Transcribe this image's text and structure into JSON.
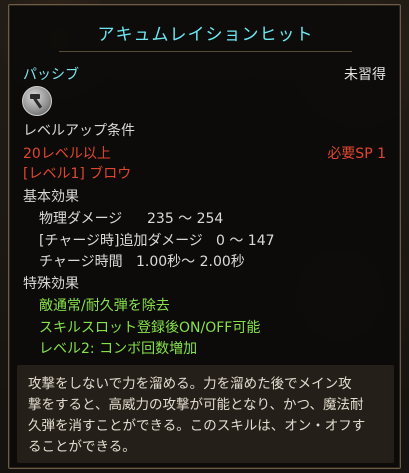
{
  "skill": {
    "name": "アキュムレイションヒット",
    "type": "パッシブ",
    "status": "未習得",
    "icon": "hammer-icon"
  },
  "levelup": {
    "title": "レベルアップ条件",
    "required_level": "20レベル以上",
    "required_sp": "必要SP 1",
    "prereq": "[レベル1] ブロウ"
  },
  "basic": {
    "title": "基本効果",
    "rows": [
      {
        "label": "物理ダメージ",
        "value": "235 ～ 254"
      },
      {
        "label": "[チャージ時]追加ダメージ",
        "value": "0 ～ 147"
      },
      {
        "label": "チャージ時間",
        "value": "1.00秒～ 2.00秒"
      }
    ]
  },
  "special": {
    "title": "特殊効果",
    "lines": [
      "敵通常/耐久弾を除去",
      "スキルスロット登録後ON/OFF可能",
      "レベル2: コンボ回数増加"
    ]
  },
  "description": "攻撃をしないで力を溜める。力を溜めた後でメイン攻\n撃をすると、高威力の攻撃が可能となり、かつ、魔法耐\n久弾を消すことができる。このスキルは、オン・オフす\nることができる。",
  "colors": {
    "name": "#6ee6f2",
    "requirement": "#e0462e",
    "special": "#86e14a"
  }
}
